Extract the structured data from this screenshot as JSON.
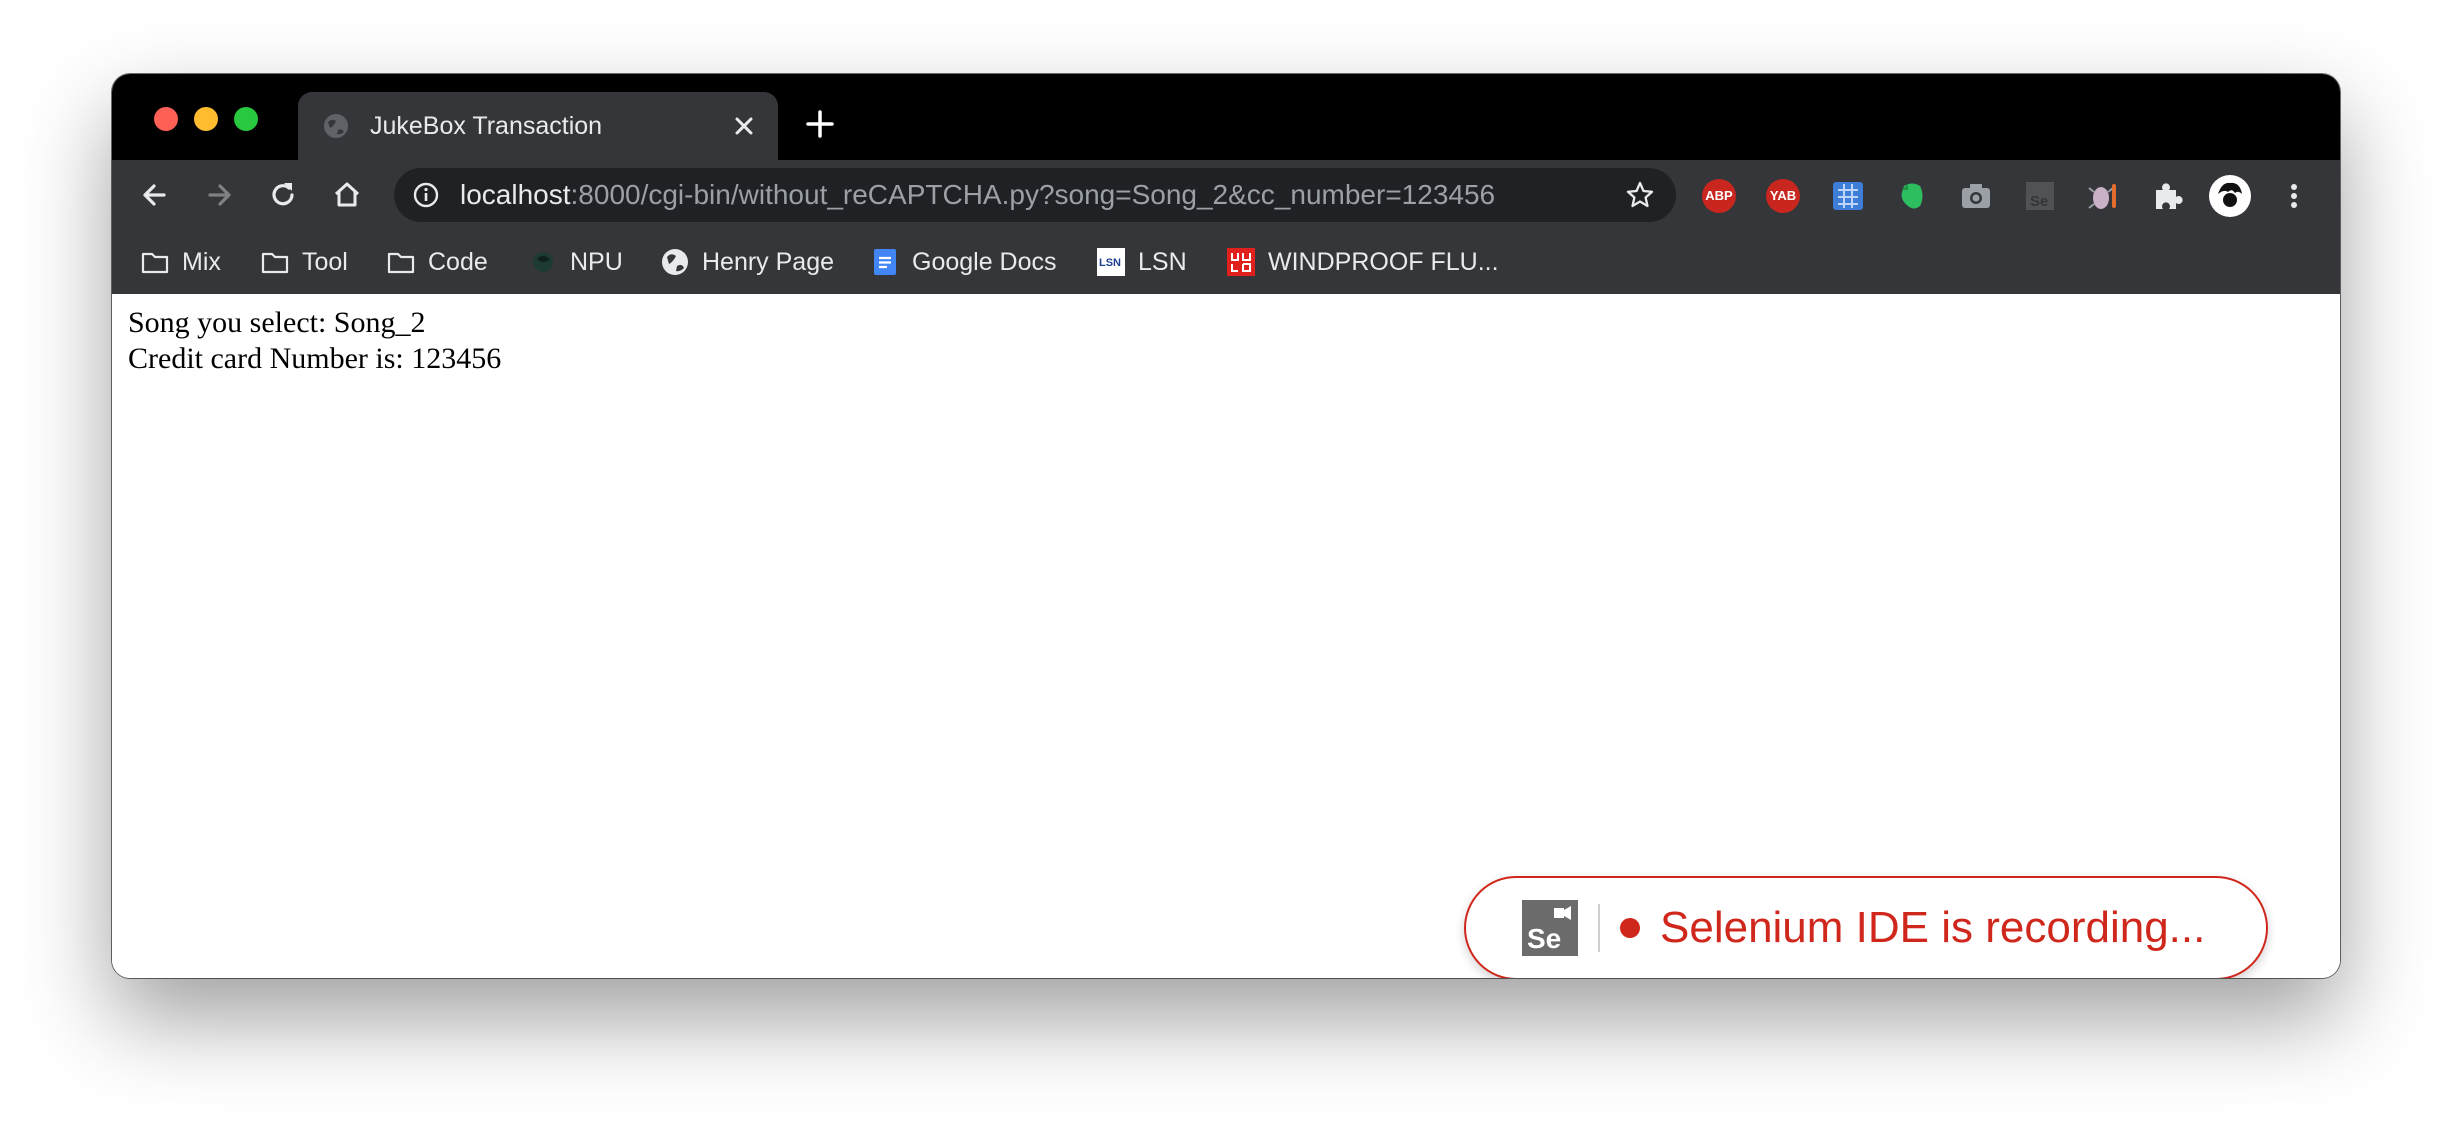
{
  "tab": {
    "title": "JukeBox Transaction"
  },
  "address_bar": {
    "url_host": "localhost",
    "url_path": ":8000/cgi-bin/without_reCAPTCHA.py?song=Song_2&cc_number=123456"
  },
  "extensions": {
    "abp_label": "ABP",
    "yab_label": "YAB"
  },
  "bookmarks": [
    {
      "label": "Mix",
      "icon": "folder-icon"
    },
    {
      "label": "Tool",
      "icon": "folder-icon"
    },
    {
      "label": "Code",
      "icon": "folder-icon"
    },
    {
      "label": "NPU",
      "icon": "npu-icon"
    },
    {
      "label": "Henry Page",
      "icon": "globe-icon"
    },
    {
      "label": "Google Docs",
      "icon": "google-docs-icon"
    },
    {
      "label": "LSN",
      "icon": "lsn-icon"
    },
    {
      "label": "WINDPROOF FLU...",
      "icon": "uniqlo-icon"
    }
  ],
  "page": {
    "line1": "Song you select: Song_2",
    "line2": "Credit card Number is: 123456"
  },
  "selenium_toast": {
    "logo_text": "Se",
    "message": "Selenium IDE is recording..."
  },
  "colors": {
    "recording_red": "#d0271c",
    "toolbar_gray": "#35363a",
    "tabstrip_black": "#000000"
  }
}
